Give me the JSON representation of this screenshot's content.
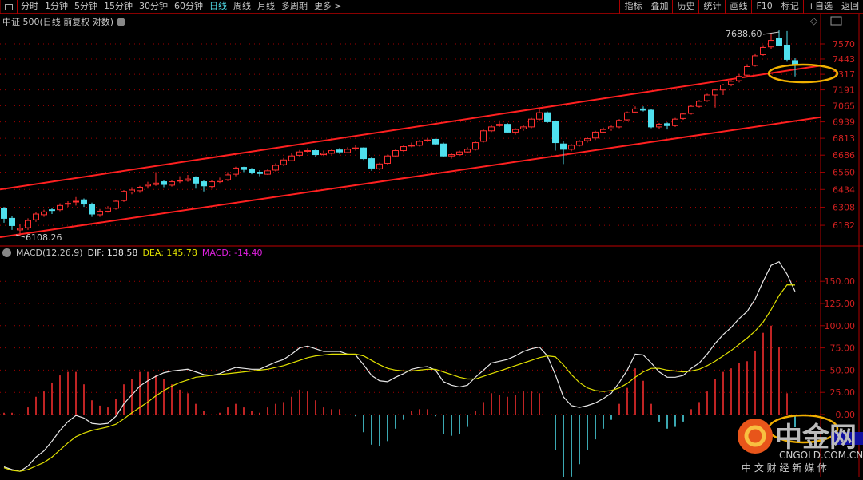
{
  "toolbar": {
    "timeframes": [
      "分时",
      "1分钟",
      "5分钟",
      "15分钟",
      "30分钟",
      "60分钟",
      "日线",
      "周线",
      "月线",
      "多周期",
      "更多 >"
    ],
    "active": "日线",
    "right": [
      "指标",
      "叠加",
      "历史",
      "统计",
      "画线",
      "F10",
      "标记",
      "+自选",
      "返回"
    ]
  },
  "title": "中证 500(日线 前复权 对数)",
  "macd_header": {
    "name": "MACD(12,26,9)",
    "dif": "DIF: 138.58",
    "dea": "DEA: 145.78",
    "macd": "MACD: -14.40"
  },
  "colors": {
    "up": "#ff3030",
    "down": "#4fe0ee",
    "dif": "#e8e8e8",
    "dea": "#e0e000",
    "grid": "#a00000",
    "ellipse": "#f0b000"
  },
  "logo": {
    "name": "中金网",
    "domain": "CNGOLD.COM.CN",
    "slogan": "中 文 财 经 新 媒 体"
  },
  "chart_data": [
    {
      "type": "candlestick",
      "title": "中证 500",
      "yscale": "log",
      "yticks": [
        7570,
        7443,
        7317,
        7191,
        7065,
        6939,
        6813,
        6686,
        6560,
        6434,
        6308,
        6182
      ],
      "annotations": {
        "max": "7688.60",
        "min": "6108.26"
      },
      "trendlines": [
        {
          "name": "upper-channel",
          "from": [
            -0.5,
            6434
          ],
          "to": [
            102.2,
            7388
          ]
        },
        {
          "name": "lower-channel",
          "from": [
            -0.5,
            6100
          ],
          "to": [
            102.2,
            6975
          ]
        }
      ],
      "ohlc": [
        [
          6300,
          6310,
          6200,
          6230
        ],
        [
          6230,
          6245,
          6150,
          6180
        ],
        [
          6150,
          6190,
          6108.26,
          6160
        ],
        [
          6165,
          6230,
          6150,
          6215
        ],
        [
          6220,
          6275,
          6205,
          6260
        ],
        [
          6255,
          6290,
          6240,
          6275
        ],
        [
          6290,
          6300,
          6260,
          6285
        ],
        [
          6290,
          6335,
          6280,
          6320
        ],
        [
          6330,
          6350,
          6310,
          6335
        ],
        [
          6345,
          6380,
          6320,
          6350
        ],
        [
          6360,
          6370,
          6310,
          6330
        ],
        [
          6330,
          6340,
          6240,
          6260
        ],
        [
          6255,
          6295,
          6240,
          6280
        ],
        [
          6280,
          6315,
          6270,
          6300
        ],
        [
          6300,
          6360,
          6290,
          6350
        ],
        [
          6355,
          6430,
          6345,
          6420
        ],
        [
          6415,
          6450,
          6400,
          6430
        ],
        [
          6425,
          6460,
          6410,
          6450
        ],
        [
          6460,
          6490,
          6440,
          6470
        ],
        [
          6470,
          6560,
          6460,
          6480
        ],
        [
          6490,
          6500,
          6450,
          6470
        ],
        [
          6465,
          6500,
          6455,
          6490
        ],
        [
          6500,
          6530,
          6480,
          6500
        ],
        [
          6500,
          6540,
          6490,
          6510
        ],
        [
          6520,
          6530,
          6440,
          6480
        ],
        [
          6490,
          6500,
          6420,
          6460
        ],
        [
          6455,
          6500,
          6440,
          6490
        ],
        [
          6490,
          6520,
          6480,
          6500
        ],
        [
          6505,
          6560,
          6495,
          6540
        ],
        [
          6545,
          6600,
          6530,
          6590
        ],
        [
          6595,
          6600,
          6560,
          6580
        ],
        [
          6580,
          6590,
          6545,
          6560
        ],
        [
          6560,
          6575,
          6530,
          6550
        ],
        [
          6545,
          6585,
          6540,
          6570
        ],
        [
          6575,
          6625,
          6565,
          6610
        ],
        [
          6615,
          6665,
          6605,
          6650
        ],
        [
          6645,
          6700,
          6640,
          6680
        ],
        [
          6685,
          6725,
          6675,
          6710
        ],
        [
          6715,
          6740,
          6700,
          6720
        ],
        [
          6720,
          6730,
          6670,
          6690
        ],
        [
          6690,
          6720,
          6680,
          6700
        ],
        [
          6700,
          6735,
          6690,
          6720
        ],
        [
          6725,
          6740,
          6695,
          6710
        ],
        [
          6705,
          6745,
          6700,
          6730
        ],
        [
          6735,
          6760,
          6720,
          6740
        ],
        [
          6740,
          6745,
          6650,
          6660
        ],
        [
          6660,
          6670,
          6570,
          6590
        ],
        [
          6585,
          6630,
          6575,
          6620
        ],
        [
          6625,
          6690,
          6615,
          6680
        ],
        [
          6680,
          6730,
          6670,
          6720
        ],
        [
          6720,
          6760,
          6710,
          6750
        ],
        [
          6755,
          6780,
          6745,
          6760
        ],
        [
          6760,
          6800,
          6750,
          6790
        ],
        [
          6795,
          6815,
          6785,
          6800
        ],
        [
          6805,
          6810,
          6760,
          6770
        ],
        [
          6770,
          6780,
          6670,
          6680
        ],
        [
          6680,
          6700,
          6660,
          6690
        ],
        [
          6690,
          6720,
          6680,
          6710
        ],
        [
          6710,
          6745,
          6700,
          6730
        ],
        [
          6730,
          6790,
          6720,
          6780
        ],
        [
          6790,
          6880,
          6780,
          6870
        ],
        [
          6870,
          6915,
          6860,
          6900
        ],
        [
          6910,
          6950,
          6900,
          6920
        ],
        [
          6920,
          6930,
          6850,
          6860
        ],
        [
          6860,
          6890,
          6840,
          6880
        ],
        [
          6885,
          6915,
          6870,
          6900
        ],
        [
          6900,
          6970,
          6890,
          6960
        ],
        [
          6960,
          7040,
          6950,
          7010
        ],
        [
          7010,
          7020,
          6930,
          6940
        ],
        [
          6940,
          6950,
          6720,
          6780
        ],
        [
          6770,
          6790,
          6620,
          6730
        ],
        [
          6730,
          6770,
          6715,
          6760
        ],
        [
          6760,
          6800,
          6750,
          6790
        ],
        [
          6795,
          6820,
          6780,
          6810
        ],
        [
          6815,
          6870,
          6800,
          6860
        ],
        [
          6860,
          6895,
          6850,
          6880
        ],
        [
          6885,
          6910,
          6870,
          6900
        ],
        [
          6900,
          6960,
          6890,
          6950
        ],
        [
          6955,
          7020,
          6945,
          7010
        ],
        [
          7015,
          7060,
          7005,
          7040
        ],
        [
          7040,
          7060,
          7020,
          7030
        ],
        [
          7030,
          7040,
          6890,
          6900
        ],
        [
          6900,
          6930,
          6885,
          6920
        ],
        [
          6925,
          6935,
          6880,
          6910
        ],
        [
          6910,
          6970,
          6900,
          6960
        ],
        [
          6965,
          7010,
          6955,
          7000
        ],
        [
          7005,
          7070,
          6995,
          7060
        ],
        [
          7060,
          7110,
          7050,
          7100
        ],
        [
          7105,
          7160,
          7095,
          7150
        ],
        [
          7150,
          7200,
          7050,
          7190
        ],
        [
          7190,
          7240,
          7150,
          7230
        ],
        [
          7235,
          7270,
          7220,
          7260
        ],
        [
          7265,
          7320,
          7250,
          7300
        ],
        [
          7310,
          7400,
          7300,
          7380
        ],
        [
          7390,
          7490,
          7380,
          7470
        ],
        [
          7480,
          7560,
          7470,
          7540
        ],
        [
          7545,
          7660,
          7530,
          7600
        ],
        [
          7620,
          7688.6,
          7550,
          7560
        ],
        [
          7560,
          7680,
          7420,
          7440
        ],
        [
          7430,
          7450,
          7300,
          7400
        ]
      ]
    },
    {
      "type": "macd",
      "yticks": [
        150,
        125,
        100,
        75,
        50,
        25,
        0
      ],
      "dif": [
        -59,
        -62,
        -64,
        -58,
        -48,
        -41,
        -30,
        -18,
        -8,
        -1,
        -4,
        -10,
        -11,
        -10,
        -2,
        12,
        22,
        32,
        38,
        43,
        47,
        49,
        50,
        51,
        48,
        45,
        44,
        46,
        50,
        53,
        52,
        51,
        51,
        55,
        59,
        62,
        68,
        75,
        77,
        74,
        71,
        71,
        71,
        68,
        67,
        56,
        44,
        38,
        37,
        42,
        46,
        51,
        53,
        54,
        50,
        37,
        33,
        31,
        33,
        42,
        50,
        58,
        60,
        62,
        66,
        71,
        74,
        76,
        66,
        45,
        20,
        10,
        8,
        10,
        13,
        18,
        24,
        36,
        50,
        68,
        67,
        58,
        48,
        42,
        42,
        44,
        52,
        58,
        68,
        80,
        90,
        98,
        108,
        116,
        130,
        150,
        168,
        172,
        158,
        138.58
      ],
      "dea": [
        -60,
        -63,
        -64,
        -62,
        -58,
        -54,
        -48,
        -40,
        -32,
        -25,
        -21,
        -18,
        -16,
        -14,
        -11,
        -5,
        2,
        8,
        14,
        21,
        27,
        32,
        36,
        39,
        42,
        43,
        44,
        45,
        46,
        47,
        48,
        49,
        50,
        51,
        53,
        55,
        58,
        61,
        64,
        66,
        67,
        68,
        68,
        68,
        68,
        66,
        61,
        56,
        52,
        50,
        49,
        49,
        50,
        51,
        51,
        48,
        45,
        42,
        40,
        40,
        43,
        46,
        49,
        52,
        55,
        58,
        61,
        64,
        66,
        65,
        56,
        45,
        36,
        30,
        27,
        26,
        27,
        30,
        35,
        42,
        48,
        52,
        52,
        50,
        49,
        48,
        49,
        51,
        55,
        60,
        66,
        72,
        79,
        86,
        94,
        104,
        118,
        134,
        146,
        145.78
      ]
    }
  ]
}
